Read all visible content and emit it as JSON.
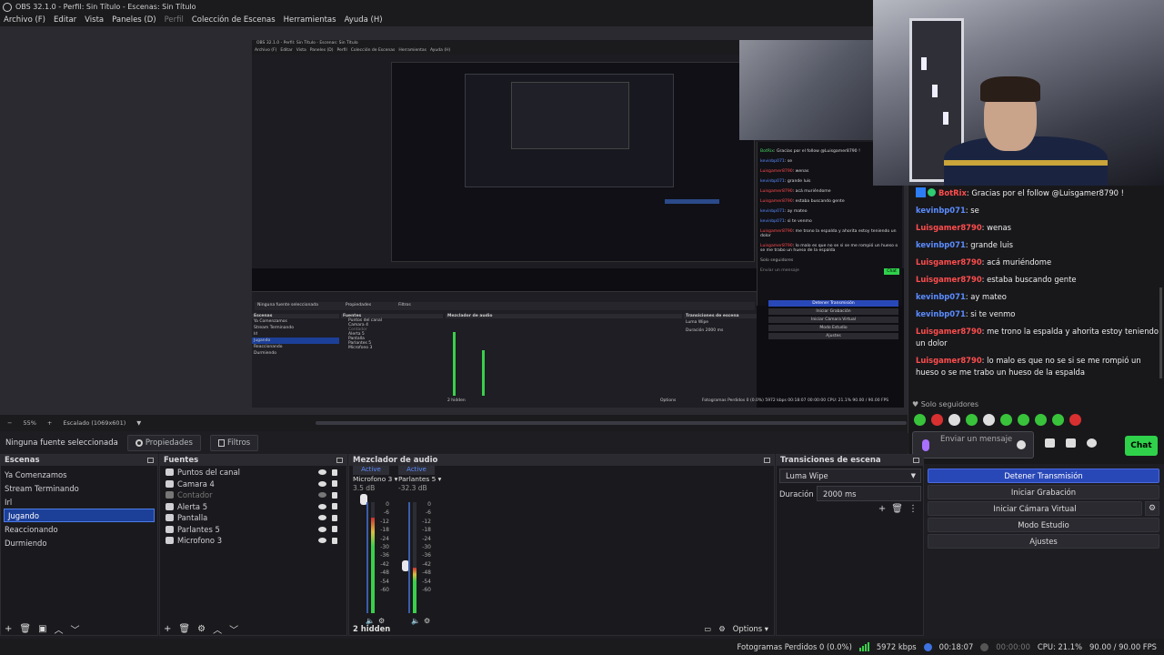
{
  "titlebar": {
    "title": "OBS 32.1.0 - Perfil: Sin Título - Escenas: Sin Título"
  },
  "menu": [
    "Archivo (F)",
    "Editar",
    "Vista",
    "Paneles (D)",
    "Perfil",
    "Colección de Escenas",
    "Herramientas",
    "Ayuda (H)"
  ],
  "preview": {
    "zoom": "55%",
    "scale_label": "Escalado (1069x601)",
    "inner_title": "OBS 32.1.0 - Perfil: Sin Título - Escenas: Sin Título",
    "inner_menu": [
      "Archivo (F)",
      "Editar",
      "Vista",
      "Paneles (D)",
      "Perfil",
      "Colección de Escenas",
      "Herramientas",
      "Ayuda (H)"
    ],
    "inner_no_source": "Ninguna fuente seleccionada",
    "inner_properties": "Propiedades",
    "inner_filters": "Filtros",
    "inner_scenes_title": "Escenas",
    "inner_scenes": [
      "Ya Comenzamos",
      "Stream Terminando",
      "Irl",
      "Jugando",
      "Reaccionando",
      "Durmiendo"
    ],
    "inner_sources_title": "Fuentes",
    "inner_sources": [
      "Puntos del canal",
      "Camara 4",
      "Contador",
      "Alerta 5",
      "Pantalla",
      "Parlantes 5",
      "Microfono 3"
    ],
    "inner_mixer_title": "Mezclador de audio",
    "inner_transitions_title": "Transiciones de escena",
    "inner_transition": "Luma Wipe",
    "inner_duration_label": "Duración",
    "inner_duration": "2000 ms",
    "inner_controls": [
      "Detener Transmisión",
      "Iniciar Grabación",
      "Iniciar Cámara Virtual",
      "Modo Estudio",
      "Ajustes"
    ],
    "inner_hidden": "2 hidden",
    "inner_options": "Options",
    "inner_status": "Fotogramas Perdidos 0 (0.0%)   5972 kbps   00:18:07   00:00:00   CPU: 21.1%   90.00 / 90.00 FPS",
    "inner_chat": [
      {
        "user": "BotRix",
        "text": ": Gracias por el follow @Luisgamer8790 !"
      },
      {
        "user": "kevinbp071",
        "text": ": se"
      },
      {
        "user": "Luisgamer8790",
        "text": ": wenas"
      },
      {
        "user": "kevinbp071",
        "text": ": grande luis"
      },
      {
        "user": "Luisgamer8790",
        "text": ": acá muriéndome"
      },
      {
        "user": "Luisgamer8790",
        "text": ": estaba buscando gente"
      },
      {
        "user": "kevinbp071",
        "text": ": ay mateo"
      },
      {
        "user": "kevinbp071",
        "text": ": si te venmo"
      },
      {
        "user": "Luisgamer8790",
        "text": ": me trono la espalda y ahorita estoy teniendo un dolor"
      },
      {
        "user": "Luisgamer8790",
        "text": ": lo malo es que no se si se me rompió un hueso o se me trabo un hueso de la espalda"
      }
    ],
    "inner_followers": "Solo seguidores",
    "inner_chat_placeholder": "Enviar un mensaje",
    "inner_chat_button": "Chat"
  },
  "chat": {
    "messages": [
      {
        "user": "BotRix",
        "text": ": Gracias por el follow @Luisgamer8790 !",
        "color": "#ff4d4d",
        "bot": true
      },
      {
        "user": "kevinbp071",
        "text": ": se",
        "color": "#5b8cff"
      },
      {
        "user": "Luisgamer8790",
        "text": ": wenas",
        "color": "#ff4d4d"
      },
      {
        "user": "kevinbp071",
        "text": ": grande luis",
        "color": "#5b8cff"
      },
      {
        "user": "Luisgamer8790",
        "text": ": acá muriéndome",
        "color": "#ff4d4d"
      },
      {
        "user": "Luisgamer8790",
        "text": ": estaba buscando gente",
        "color": "#ff4d4d"
      },
      {
        "user": "kevinbp071",
        "text": ": ay mateo",
        "color": "#5b8cff"
      },
      {
        "user": "kevinbp071",
        "text": ": si te venmo",
        "color": "#5b8cff"
      },
      {
        "user": "Luisgamer8790",
        "text": ": me trono la espalda y ahorita estoy teniendo un dolor",
        "color": "#ff4d4d"
      },
      {
        "user": "Luisgamer8790",
        "text": ": lo malo es que no se si se me rompió un hueso o se me trabo un hueso de la espalda",
        "color": "#ff4d4d"
      }
    ],
    "followers_label": "Solo seguidores",
    "input_placeholder": "Enviar un mensaje",
    "send_button": "Chat"
  },
  "source_bar": {
    "no_source": "Ninguna fuente seleccionada",
    "properties": "Propiedades",
    "filters": "Filtros"
  },
  "scenes": {
    "title": "Escenas",
    "items": [
      "Ya Comenzamos",
      "Stream Terminando",
      "Irl",
      "Jugando",
      "Reaccionando",
      "Durmiendo"
    ],
    "selected_index": 3
  },
  "sources": {
    "title": "Fuentes",
    "items": [
      {
        "label": "Puntos del canal",
        "icon": "browser-icon"
      },
      {
        "label": "Camara 4",
        "icon": "camera-icon"
      },
      {
        "label": "Contador",
        "icon": "browser-icon",
        "hidden": true
      },
      {
        "label": "Alerta 5",
        "icon": "browser-icon"
      },
      {
        "label": "Pantalla",
        "icon": "display-icon"
      },
      {
        "label": "Parlantes 5",
        "icon": "speaker-icon"
      },
      {
        "label": "Microfono 3",
        "icon": "mic-icon"
      }
    ]
  },
  "mixer": {
    "title": "Mezclador de audio",
    "channels": [
      {
        "active": "Active",
        "name": "Microfono 3",
        "db": "3.5 dB",
        "level": 0.86
      },
      {
        "active": "Active",
        "name": "Parlantes 5",
        "db": "-32.3 dB",
        "level": 0.41
      }
    ],
    "scale": [
      "0",
      "-6",
      "-12",
      "-18",
      "-24",
      "-30",
      "-36",
      "-42",
      "-48",
      "-54",
      "-60"
    ],
    "hidden": "2 hidden",
    "options": "Options"
  },
  "transitions": {
    "title": "Transiciones de escena",
    "selected": "Luma Wipe",
    "duration_label": "Duración",
    "duration": "2000 ms"
  },
  "controls": {
    "stop_stream": "Detener Transmisión",
    "start_recording": "Iniciar Grabación",
    "start_virtual_cam": "Iniciar Cámara Virtual",
    "studio_mode": "Modo Estudio",
    "settings": "Ajustes"
  },
  "status": {
    "dropped_frames": "Fotogramas Perdidos 0 (0.0%)",
    "bitrate": "5972 kbps",
    "stream_time": "00:18:07",
    "rec_time": "00:00:00",
    "cpu": "CPU: 21.1%",
    "fps": "90.00 / 90.00 FPS"
  },
  "colors": {
    "accent": "#2948b8",
    "username_red": "#ff4d4d",
    "username_blue": "#5b8cff",
    "chat_button": "#2fd14a"
  }
}
